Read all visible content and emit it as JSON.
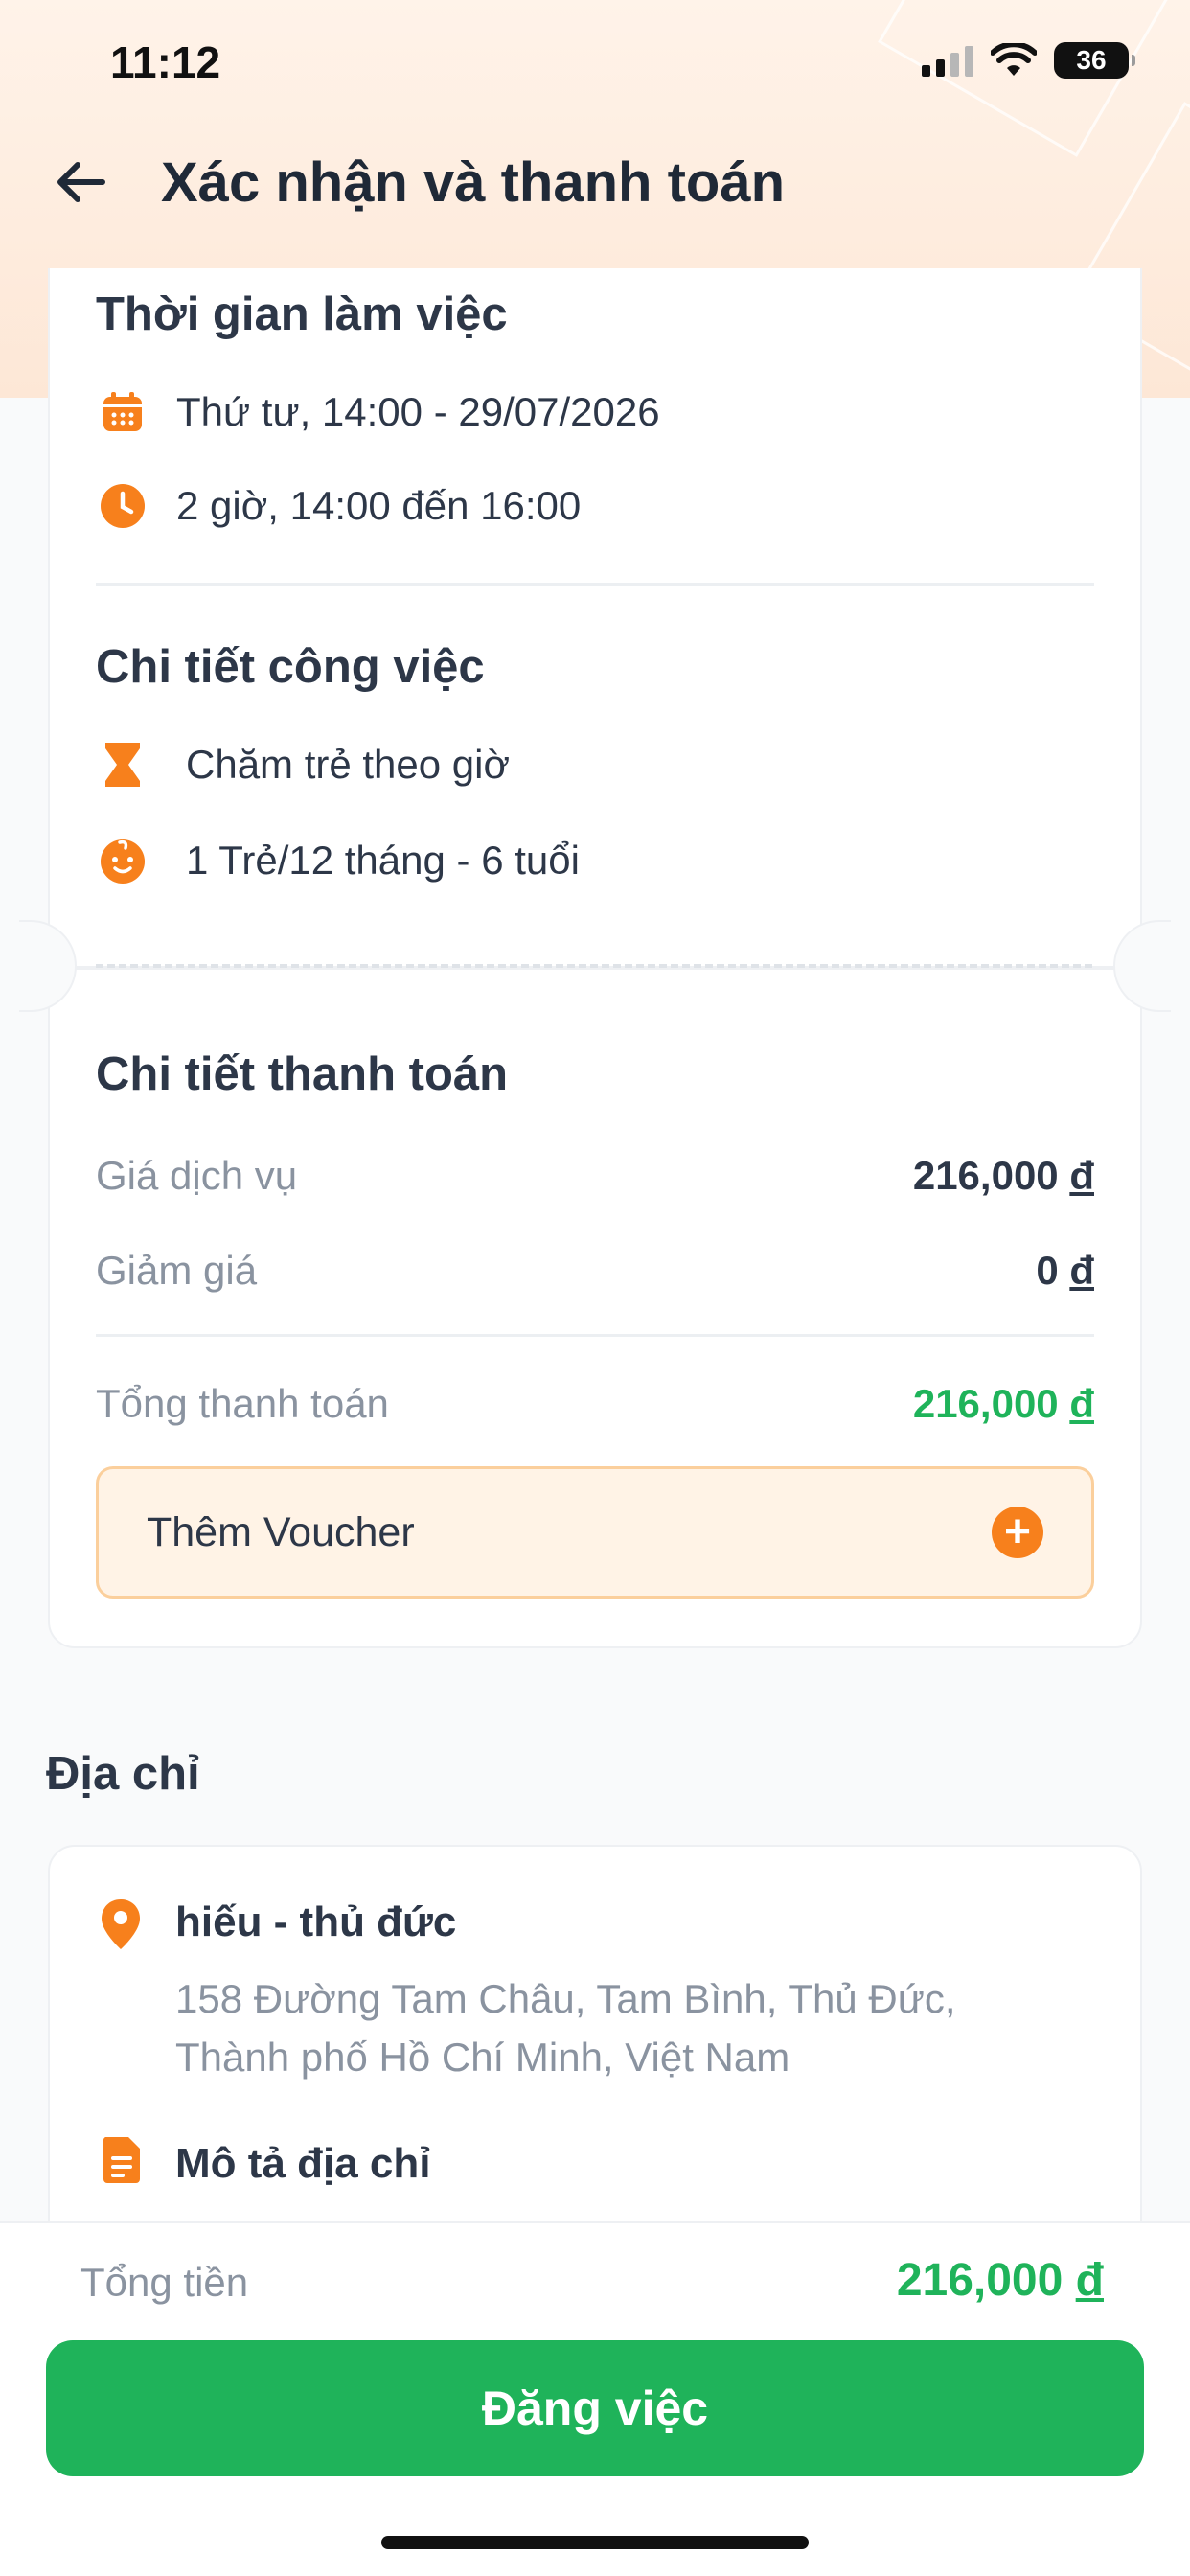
{
  "status_bar": {
    "time": "11:12",
    "battery": "36"
  },
  "header": {
    "title": "Xác nhận và thanh toán"
  },
  "work_time": {
    "title": "Thời gian làm việc",
    "date": "Thứ tư, 14:00 - 29/07/2026",
    "duration": "2 giờ, 14:00 đến 16:00"
  },
  "job_details": {
    "title": "Chi tiết công việc",
    "service": "Chăm trẻ theo giờ",
    "children": "1 Trẻ/12 tháng - 6 tuổi"
  },
  "payment": {
    "title": "Chi tiết thanh toán",
    "service_price_label": "Giá dịch vụ",
    "service_price_value": "216,000",
    "discount_label": "Giảm giá",
    "discount_value": "0",
    "total_label": "Tổng thanh toán",
    "total_value": "216,000",
    "currency": "đ",
    "voucher_label": "Thêm Voucher"
  },
  "address": {
    "heading": "Địa chỉ",
    "name": "hiếu - thủ đức",
    "line1": "158 Đường Tam Châu, Tam Bình, Thủ Đức,",
    "line2": "Thành phố Hồ Chí Minh, Việt Nam",
    "description_title": "Mô tả địa chỉ"
  },
  "footer": {
    "total_label": "Tổng tiền",
    "total_value": "216,000",
    "currency": "đ",
    "post_button": "Đăng việc"
  },
  "colors": {
    "accent": "#f7801c",
    "primary": "#1fb35a",
    "text": "#2d3748"
  }
}
